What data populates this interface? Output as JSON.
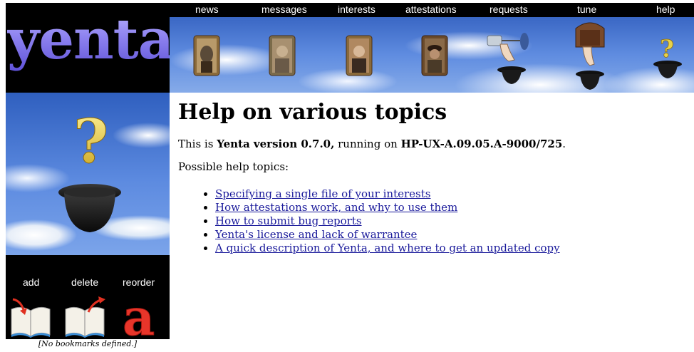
{
  "logo": {
    "text": "yenta"
  },
  "nav": {
    "items": [
      {
        "label": "news"
      },
      {
        "label": "messages"
      },
      {
        "label": "interests"
      },
      {
        "label": "attestations"
      },
      {
        "label": "requests"
      },
      {
        "label": "tune"
      },
      {
        "label": "help"
      }
    ]
  },
  "banner": {
    "icons": [
      "news-icon",
      "messages-icon",
      "interests-icon",
      "attestations-icon",
      "requests-icon",
      "tune-icon",
      "help-icon"
    ]
  },
  "bookmarks": {
    "add_label": "add",
    "delete_label": "delete",
    "reorder_label": "reorder",
    "empty_text": "[No bookmarks defined.]"
  },
  "main": {
    "title": "Help on various topics",
    "version_prefix": "This is ",
    "version_name": "Yenta version 0.7.0,",
    "version_mid": " running on ",
    "platform": "HP-UX-A.09.05.A-9000/725",
    "version_suffix": ".",
    "topics_label": "Possible help topics:",
    "topics": [
      {
        "label": "Specifying a single file of your interests"
      },
      {
        "label": "How attestations work, and why to use them"
      },
      {
        "label": "How to submit bug reports"
      },
      {
        "label": "Yenta's license and lack of warrantee"
      },
      {
        "label": "A quick description of Yenta, and where to get an updated copy"
      }
    ]
  },
  "colors": {
    "link": "#1a1a9b",
    "logo": "#8e83f0",
    "sky": "#5d8be0"
  }
}
